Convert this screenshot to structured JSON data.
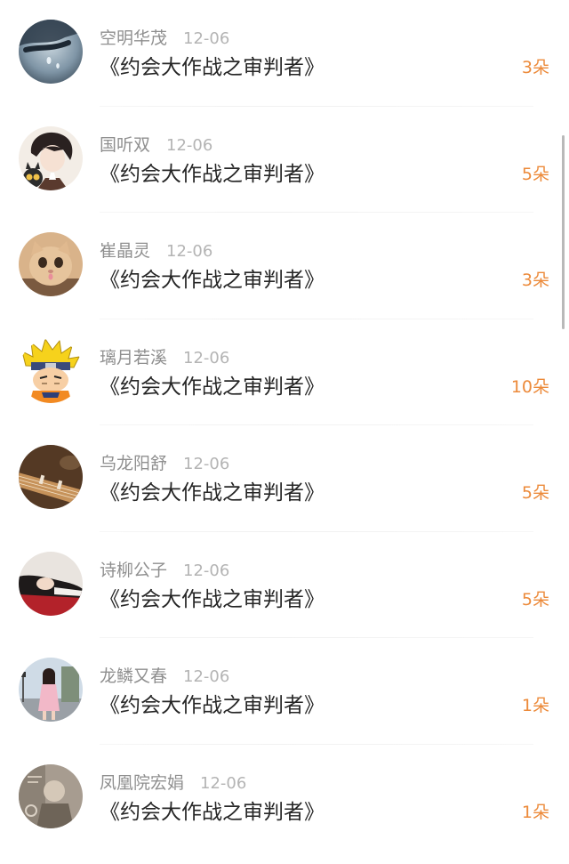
{
  "gifts": [
    {
      "name": "空明华茂",
      "date": "12-06",
      "title": "《约会大作战之审判者》",
      "count": "3朵",
      "avatar_icon": "water-drop-avatar-icon"
    },
    {
      "name": "国听双",
      "date": "12-06",
      "title": "《约会大作战之审判者》",
      "count": "5朵",
      "avatar_icon": "anime-boy-avatar-icon"
    },
    {
      "name": "崔晶灵",
      "date": "12-06",
      "title": "《约会大作战之审判者》",
      "count": "3朵",
      "avatar_icon": "cat-avatar-icon"
    },
    {
      "name": "璃月若溪",
      "date": "12-06",
      "title": "《约会大作战之审判者》",
      "count": "10朵",
      "avatar_icon": "cartoon-ninja-avatar-icon"
    },
    {
      "name": "乌龙阳舒",
      "date": "12-06",
      "title": "《约会大作战之审判者》",
      "count": "5朵",
      "avatar_icon": "guzheng-avatar-icon"
    },
    {
      "name": "诗柳公子",
      "date": "12-06",
      "title": "《约会大作战之审判者》",
      "count": "5朵",
      "avatar_icon": "lying-girl-avatar-icon"
    },
    {
      "name": "龙鳞又春",
      "date": "12-06",
      "title": "《约会大作战之审判者》",
      "count": "1朵",
      "avatar_icon": "street-girl-avatar-icon"
    },
    {
      "name": "凤凰院宏娟",
      "date": "12-06",
      "title": "《约会大作战之审判者》",
      "count": "1朵",
      "avatar_icon": "sepia-photo-avatar-icon"
    }
  ],
  "colors": {
    "count": "#ec8a3a",
    "name": "#8f8f8f",
    "date": "#b4b4b4",
    "title": "#262626"
  }
}
